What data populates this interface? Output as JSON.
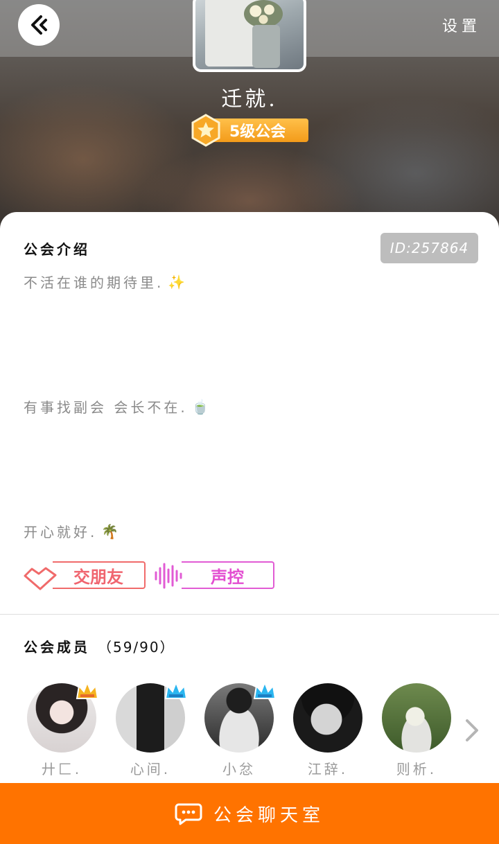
{
  "header": {
    "settings_label": "设置",
    "guild_name": "迁就.",
    "level_label": "5级公会"
  },
  "intro": {
    "title": "公会介绍",
    "id_label": "ID:257864",
    "lines": [
      {
        "text": "不活在谁的期待里.",
        "emoji": "✨"
      },
      {
        "text": "有事找副会  会长不在.",
        "emoji": "🍵"
      },
      {
        "text": "开心就好.",
        "emoji": "🌴"
      }
    ],
    "tags": [
      "交朋友",
      "声控"
    ]
  },
  "members": {
    "title": "公会成员",
    "count": "（59/90）",
    "list": [
      {
        "name": "廾匚.",
        "crown": "gold"
      },
      {
        "name": "心间.",
        "crown": "blue"
      },
      {
        "name": "小忿",
        "crown": "blue"
      },
      {
        "name": "江辞.",
        "crown": ""
      },
      {
        "name": "则析.",
        "crown": ""
      }
    ]
  },
  "chat": {
    "label": "公会聊天室"
  },
  "colors": {
    "accent": "#ff7300",
    "level_badge": "#f7a827",
    "tag_friend": "#f0656f",
    "tag_voice": "#e34fd1",
    "crown_gold": "#f5b320",
    "crown_blue": "#2bb6f0"
  }
}
